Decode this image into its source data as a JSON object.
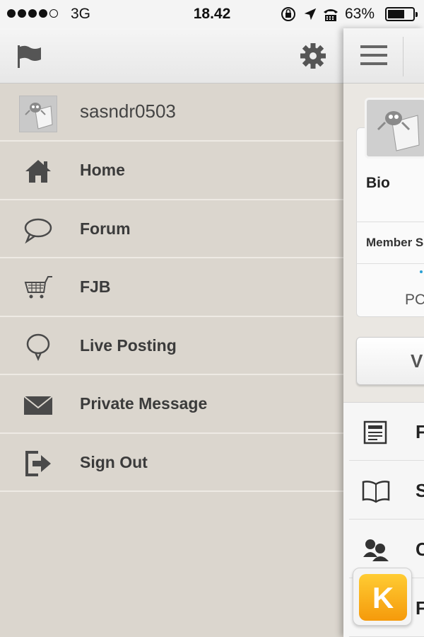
{
  "status_bar": {
    "carrier": "3G",
    "time": "18.42",
    "battery_pct": "63%",
    "signal_bars": 4
  },
  "drawer": {
    "toolbar": {
      "left_icon": "flag-icon",
      "right_icon": "gear-icon"
    },
    "user": {
      "username": "sasndr0503"
    },
    "items": [
      {
        "label": "Home",
        "icon": "home-icon"
      },
      {
        "label": "Forum",
        "icon": "speech-bubble-icon"
      },
      {
        "label": "FJB",
        "icon": "cart-icon"
      },
      {
        "label": "Live Posting",
        "icon": "live-bubble-icon"
      },
      {
        "label": "Private Message",
        "icon": "envelope-icon"
      },
      {
        "label": "Sign Out",
        "icon": "sign-out-icon"
      }
    ]
  },
  "main": {
    "toolbar": {
      "menu_icon": "hamburger-icon"
    },
    "profile": {
      "bio_label": "Bio",
      "member_label": "Member S",
      "posts_label": "PC"
    },
    "view_button": "V",
    "list": [
      {
        "label": "F",
        "icon": "newspaper-icon"
      },
      {
        "label": "S",
        "icon": "book-icon"
      },
      {
        "label": "C",
        "icon": "people-icon"
      },
      {
        "label": "F",
        "icon": "folder-icon"
      }
    ],
    "kaskus_badge": "K"
  },
  "colors": {
    "drawer_bg": "#dbd6ce",
    "text_dark": "#3b3b3b",
    "accent_orange": "#f5a20b"
  }
}
